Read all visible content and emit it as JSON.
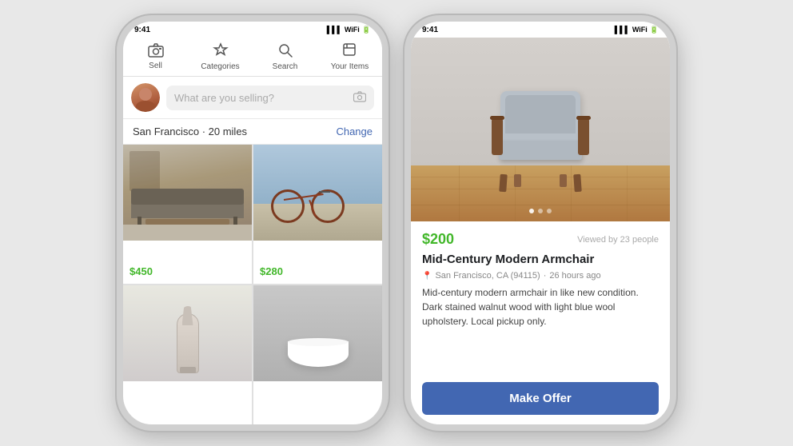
{
  "background": "#e8e8e8",
  "phone1": {
    "statusBar": {
      "time": "9:41",
      "icons": "● ▲ ■"
    },
    "nav": {
      "items": [
        {
          "id": "sell",
          "icon": "📷",
          "label": "Sell"
        },
        {
          "id": "categories",
          "icon": "★",
          "label": "Categories"
        },
        {
          "id": "search",
          "icon": "🔍",
          "label": "Search"
        },
        {
          "id": "your-items",
          "icon": "🏷",
          "label": "Your Items"
        }
      ]
    },
    "searchBar": {
      "placeholder": "What are you selling?",
      "cameraIcon": "📷"
    },
    "location": {
      "text": "San Francisco · 20 miles",
      "changeLabel": "Change"
    },
    "items": [
      {
        "id": "sofa",
        "price": "$450",
        "type": "sofa"
      },
      {
        "id": "bike",
        "price": "$280",
        "type": "bike"
      },
      {
        "id": "lamp",
        "price": "",
        "type": "lamp"
      },
      {
        "id": "bowl",
        "price": "",
        "type": "bowl"
      }
    ]
  },
  "phone2": {
    "statusBar": {
      "time": "9:41"
    },
    "detail": {
      "price": "$200",
      "viewedBy": "Viewed by 23 people",
      "title": "Mid-Century Modern Armchair",
      "location": "San Francisco, CA (94115)",
      "timeAgo": "26 hours ago",
      "description": "Mid-century modern armchair in like new condition. Dark stained walnut wood with light blue wool upholstery. Local pickup only.",
      "makeOfferLabel": "Make Offer",
      "dots": [
        true,
        false,
        false
      ],
      "pinIcon": "📍"
    }
  }
}
